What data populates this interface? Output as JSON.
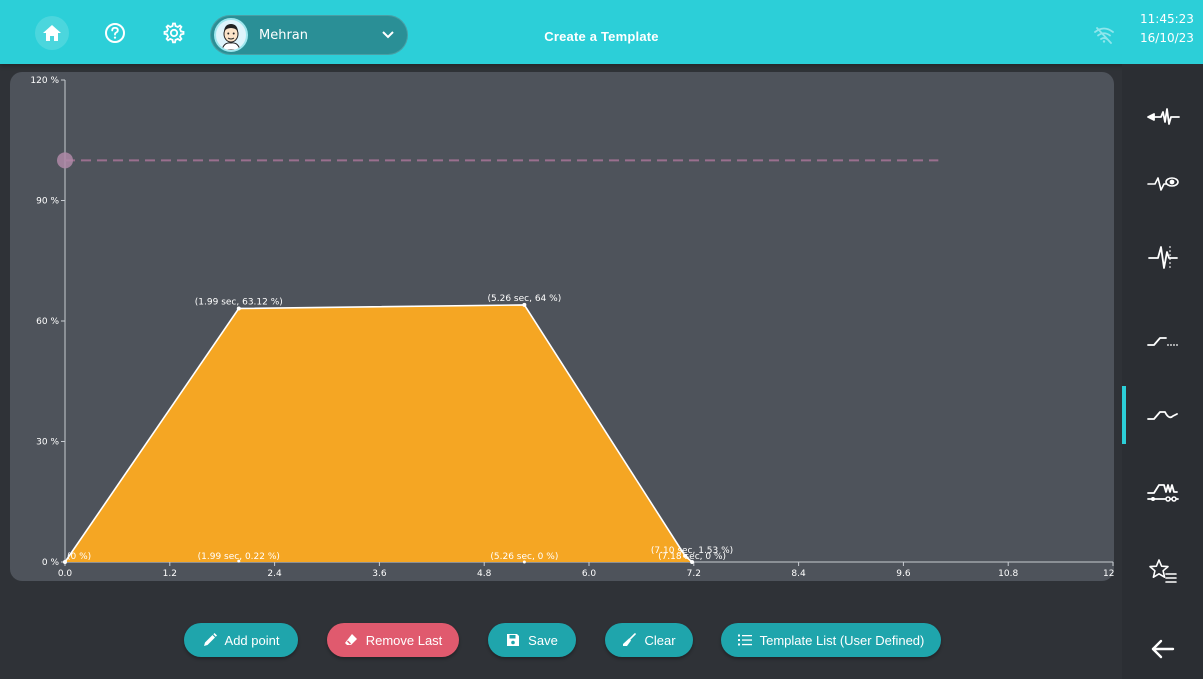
{
  "header": {
    "title": "Create a Template",
    "user": {
      "name": "Mehran"
    },
    "time": "11:45:23",
    "date": "16/10/23",
    "icons": [
      "home-icon",
      "help-icon",
      "gear-icon",
      "wifi-off-icon"
    ]
  },
  "toolbar": {
    "add_point": "Add point",
    "remove_last": "Remove Last",
    "save": "Save",
    "clear": "Clear",
    "template_list": "Template List (User Defined)"
  },
  "sidebar": {
    "items": [
      {
        "icon": "waveform-pointer-icon",
        "active": false
      },
      {
        "icon": "waveform-eye-icon",
        "active": false
      },
      {
        "icon": "waveform-spike-icon",
        "active": false
      },
      {
        "icon": "ramp-dotted-icon",
        "active": false
      },
      {
        "icon": "ramp-wave-icon",
        "active": true
      },
      {
        "icon": "ramp-settings-icon",
        "active": false
      },
      {
        "icon": "favorite-list-icon",
        "active": false
      }
    ],
    "back_icon": "arrow-left-icon"
  },
  "colors": {
    "header": "#2ccfd8",
    "fill": "#f5a623",
    "danger": "#e05a6e",
    "accent": "#1fa5ac",
    "limit_line": "#9a6f8e"
  },
  "chart_data": {
    "type": "area",
    "x_ticks": [
      "0.0",
      "1.2",
      "2.4",
      "3.6",
      "4.8",
      "6.0",
      "7.2",
      "8.4",
      "9.6",
      "10.8",
      "12.0"
    ],
    "y_ticks": [
      "0 %",
      "30 %",
      "60 %",
      "90 %",
      "120 %"
    ],
    "xlim": [
      0,
      12
    ],
    "ylim": [
      0,
      120
    ],
    "limit_line": {
      "y": 100
    },
    "points": [
      {
        "x": 0,
        "y": 0
      },
      {
        "x": 1.99,
        "y": 63.12
      },
      {
        "x": 5.26,
        "y": 64
      },
      {
        "x": 7.1,
        "y": 1.53
      },
      {
        "x": 7.18,
        "y": 0
      }
    ],
    "base_points": [
      {
        "x": 1.99,
        "y": 0.22
      },
      {
        "x": 5.26,
        "y": 0
      }
    ],
    "labels": [
      {
        "text": "(0 %)",
        "x": 0,
        "y": 0,
        "anchor": "start"
      },
      {
        "text": "(1.99 sec, 63.12 %)",
        "x": 1.99,
        "y": 63.12,
        "anchor": "middle"
      },
      {
        "text": "(5.26 sec, 64 %)",
        "x": 5.26,
        "y": 64,
        "anchor": "middle"
      },
      {
        "text": "(1.99 sec, 0.22 %)",
        "x": 1.99,
        "y": 0,
        "anchor": "middle"
      },
      {
        "text": "(5.26 sec, 0 %)",
        "x": 5.26,
        "y": 0,
        "anchor": "middle"
      },
      {
        "text": "(7.10 sec, 1.53 %)",
        "x": 7.18,
        "y": 1.53,
        "anchor": "middle"
      },
      {
        "text": "(7.18 sec, 0 %)",
        "x": 7.18,
        "y": 0,
        "anchor": "middle"
      }
    ]
  }
}
